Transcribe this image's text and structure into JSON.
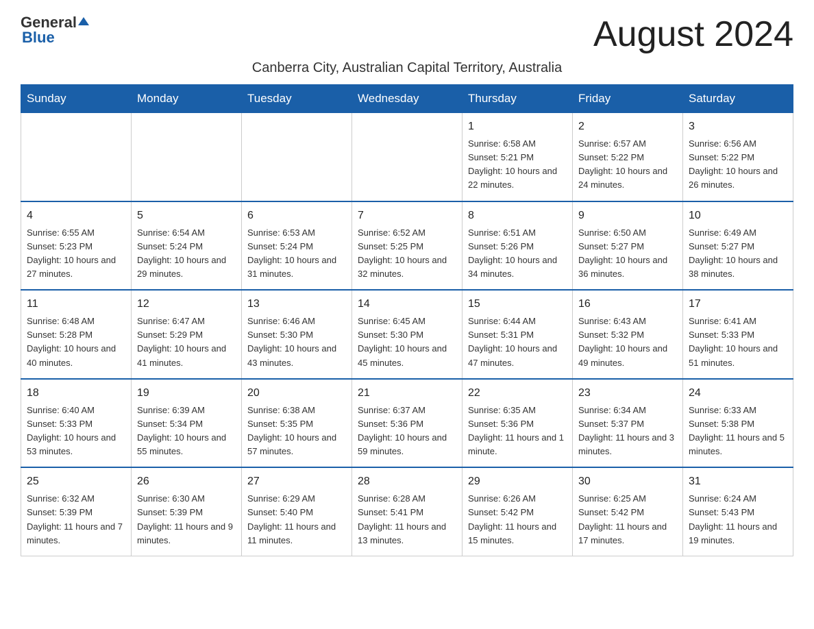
{
  "logo": {
    "text_general": "General",
    "text_blue": "Blue"
  },
  "header": {
    "month_year": "August 2024",
    "subtitle": "Canberra City, Australian Capital Territory, Australia"
  },
  "columns": [
    "Sunday",
    "Monday",
    "Tuesday",
    "Wednesday",
    "Thursday",
    "Friday",
    "Saturday"
  ],
  "weeks": [
    [
      {
        "day": "",
        "info": ""
      },
      {
        "day": "",
        "info": ""
      },
      {
        "day": "",
        "info": ""
      },
      {
        "day": "",
        "info": ""
      },
      {
        "day": "1",
        "info": "Sunrise: 6:58 AM\nSunset: 5:21 PM\nDaylight: 10 hours and 22 minutes."
      },
      {
        "day": "2",
        "info": "Sunrise: 6:57 AM\nSunset: 5:22 PM\nDaylight: 10 hours and 24 minutes."
      },
      {
        "day": "3",
        "info": "Sunrise: 6:56 AM\nSunset: 5:22 PM\nDaylight: 10 hours and 26 minutes."
      }
    ],
    [
      {
        "day": "4",
        "info": "Sunrise: 6:55 AM\nSunset: 5:23 PM\nDaylight: 10 hours and 27 minutes."
      },
      {
        "day": "5",
        "info": "Sunrise: 6:54 AM\nSunset: 5:24 PM\nDaylight: 10 hours and 29 minutes."
      },
      {
        "day": "6",
        "info": "Sunrise: 6:53 AM\nSunset: 5:24 PM\nDaylight: 10 hours and 31 minutes."
      },
      {
        "day": "7",
        "info": "Sunrise: 6:52 AM\nSunset: 5:25 PM\nDaylight: 10 hours and 32 minutes."
      },
      {
        "day": "8",
        "info": "Sunrise: 6:51 AM\nSunset: 5:26 PM\nDaylight: 10 hours and 34 minutes."
      },
      {
        "day": "9",
        "info": "Sunrise: 6:50 AM\nSunset: 5:27 PM\nDaylight: 10 hours and 36 minutes."
      },
      {
        "day": "10",
        "info": "Sunrise: 6:49 AM\nSunset: 5:27 PM\nDaylight: 10 hours and 38 minutes."
      }
    ],
    [
      {
        "day": "11",
        "info": "Sunrise: 6:48 AM\nSunset: 5:28 PM\nDaylight: 10 hours and 40 minutes."
      },
      {
        "day": "12",
        "info": "Sunrise: 6:47 AM\nSunset: 5:29 PM\nDaylight: 10 hours and 41 minutes."
      },
      {
        "day": "13",
        "info": "Sunrise: 6:46 AM\nSunset: 5:30 PM\nDaylight: 10 hours and 43 minutes."
      },
      {
        "day": "14",
        "info": "Sunrise: 6:45 AM\nSunset: 5:30 PM\nDaylight: 10 hours and 45 minutes."
      },
      {
        "day": "15",
        "info": "Sunrise: 6:44 AM\nSunset: 5:31 PM\nDaylight: 10 hours and 47 minutes."
      },
      {
        "day": "16",
        "info": "Sunrise: 6:43 AM\nSunset: 5:32 PM\nDaylight: 10 hours and 49 minutes."
      },
      {
        "day": "17",
        "info": "Sunrise: 6:41 AM\nSunset: 5:33 PM\nDaylight: 10 hours and 51 minutes."
      }
    ],
    [
      {
        "day": "18",
        "info": "Sunrise: 6:40 AM\nSunset: 5:33 PM\nDaylight: 10 hours and 53 minutes."
      },
      {
        "day": "19",
        "info": "Sunrise: 6:39 AM\nSunset: 5:34 PM\nDaylight: 10 hours and 55 minutes."
      },
      {
        "day": "20",
        "info": "Sunrise: 6:38 AM\nSunset: 5:35 PM\nDaylight: 10 hours and 57 minutes."
      },
      {
        "day": "21",
        "info": "Sunrise: 6:37 AM\nSunset: 5:36 PM\nDaylight: 10 hours and 59 minutes."
      },
      {
        "day": "22",
        "info": "Sunrise: 6:35 AM\nSunset: 5:36 PM\nDaylight: 11 hours and 1 minute."
      },
      {
        "day": "23",
        "info": "Sunrise: 6:34 AM\nSunset: 5:37 PM\nDaylight: 11 hours and 3 minutes."
      },
      {
        "day": "24",
        "info": "Sunrise: 6:33 AM\nSunset: 5:38 PM\nDaylight: 11 hours and 5 minutes."
      }
    ],
    [
      {
        "day": "25",
        "info": "Sunrise: 6:32 AM\nSunset: 5:39 PM\nDaylight: 11 hours and 7 minutes."
      },
      {
        "day": "26",
        "info": "Sunrise: 6:30 AM\nSunset: 5:39 PM\nDaylight: 11 hours and 9 minutes."
      },
      {
        "day": "27",
        "info": "Sunrise: 6:29 AM\nSunset: 5:40 PM\nDaylight: 11 hours and 11 minutes."
      },
      {
        "day": "28",
        "info": "Sunrise: 6:28 AM\nSunset: 5:41 PM\nDaylight: 11 hours and 13 minutes."
      },
      {
        "day": "29",
        "info": "Sunrise: 6:26 AM\nSunset: 5:42 PM\nDaylight: 11 hours and 15 minutes."
      },
      {
        "day": "30",
        "info": "Sunrise: 6:25 AM\nSunset: 5:42 PM\nDaylight: 11 hours and 17 minutes."
      },
      {
        "day": "31",
        "info": "Sunrise: 6:24 AM\nSunset: 5:43 PM\nDaylight: 11 hours and 19 minutes."
      }
    ]
  ]
}
